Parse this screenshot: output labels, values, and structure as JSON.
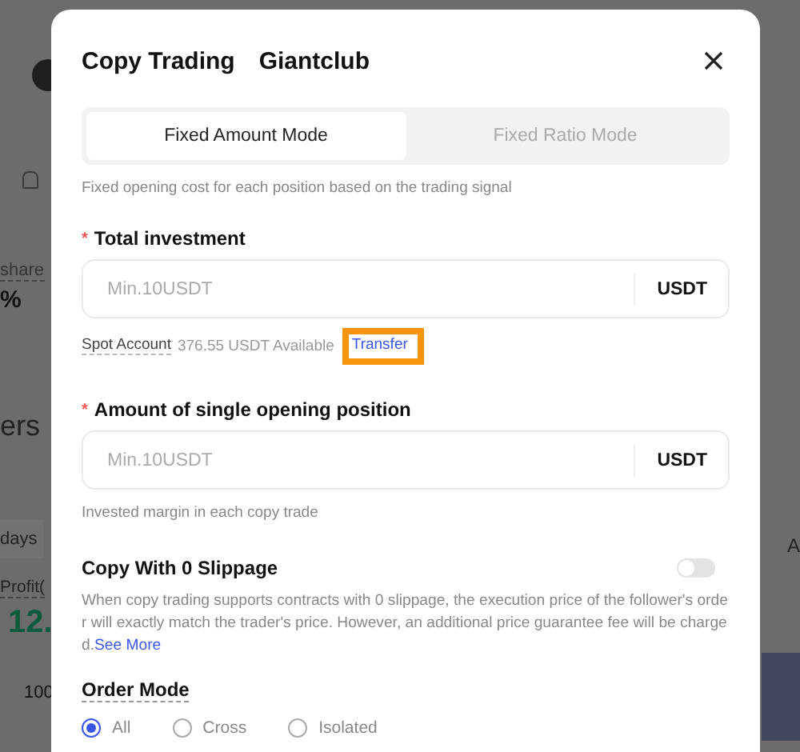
{
  "background": {
    "share_label": "share",
    "percent": "%",
    "heading": "ers",
    "period_tab": "days",
    "profit_label": "Profit(",
    "profit_value": "12.",
    "row_value": "100",
    "right_label": "A"
  },
  "dialog": {
    "title": "Copy Trading",
    "trader": "Giantclub",
    "tabs": [
      {
        "label": "Fixed Amount Mode",
        "selected": true
      },
      {
        "label": "Fixed Ratio Mode",
        "selected": false
      }
    ],
    "mode_hint": "Fixed opening cost for each position based on the trading signal",
    "total_investment": {
      "label": "Total investment",
      "required_mark": "*",
      "placeholder": "Min.10USDT",
      "unit": "USDT"
    },
    "balance": {
      "account": "Spot Account",
      "amount": "376.55 USDT",
      "available": "Available",
      "transfer": "Transfer",
      "highlighted": true
    },
    "single_position": {
      "label": "Amount of single opening position",
      "required_mark": "*",
      "placeholder": "Min.10USDT",
      "unit": "USDT"
    },
    "single_hint": "Invested margin in each copy trade",
    "slippage": {
      "label": "Copy With 0 Slippage",
      "on": false,
      "description": "When copy trading supports contracts with 0 slippage, the execution price of the follower's order will exactly match the trader's price. However, an additional price guarantee fee will be charged.",
      "link": "See More"
    },
    "order_mode": {
      "label": "Order Mode",
      "options": [
        {
          "label": "All",
          "selected": true
        },
        {
          "label": "Cross",
          "selected": false
        },
        {
          "label": "Isolated",
          "selected": false
        }
      ]
    }
  }
}
